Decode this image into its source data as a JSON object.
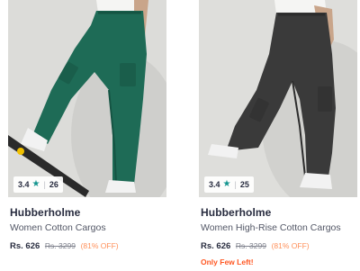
{
  "products": [
    {
      "brand": "Hubberholme",
      "name": "Women Cotton Cargos",
      "price": "Rs. 626",
      "mrp": "Rs. 3299",
      "discount": "(81% OFF)",
      "rating": "3.4",
      "rating_count": "26",
      "urgency": "",
      "image": {
        "subject": "green cargo trousers",
        "garment_color": "#1e6b56",
        "shoe": "white sneaker"
      }
    },
    {
      "brand": "Hubberholme",
      "name": "Women High-Rise Cotton Cargos",
      "price": "Rs. 626",
      "mrp": "Rs. 3299",
      "discount": "(81% OFF)",
      "rating": "3.4",
      "rating_count": "25",
      "urgency": "Only Few Left!",
      "image": {
        "subject": "charcoal cargo trousers",
        "garment_color": "#3a3a3a",
        "shoe": "white sneaker"
      }
    }
  ],
  "colors": {
    "brand_text": "#282c3f",
    "subtitle_text": "#535766",
    "strike_text": "#7e818c",
    "discount_text": "#ff905a",
    "urgency_text": "#ff5722",
    "rating_star": "#14958f"
  },
  "icons": {
    "rating_star": "star-icon"
  }
}
